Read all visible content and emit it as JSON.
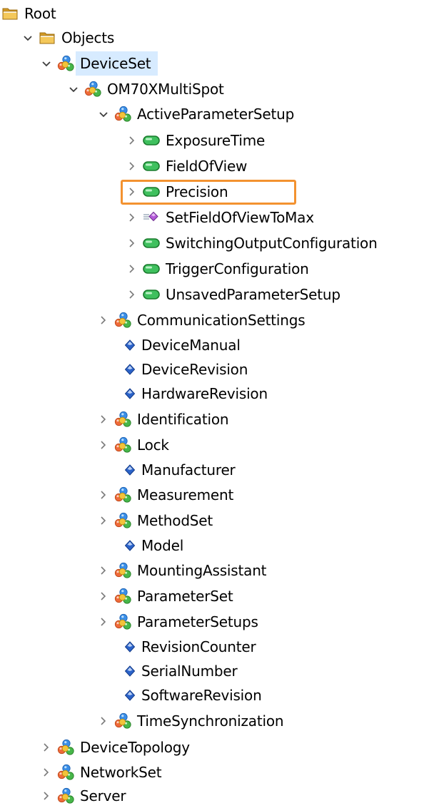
{
  "colors": {
    "highlight_border": "#f39230",
    "selection_fill": "#d7ebff",
    "chevron": "#7a7a7a",
    "folder": "#e9b844",
    "variable": "#2fb05a",
    "method": "#b35ad8",
    "property": "#2b63c9"
  },
  "icon_names": {
    "folder": "folder-icon",
    "object": "object-icon",
    "variable": "variable-icon",
    "method": "method-icon",
    "property": "property-icon"
  },
  "tree": {
    "root": {
      "label": "Root"
    },
    "objects": {
      "label": "Objects"
    },
    "device_set": {
      "label": "DeviceSet"
    },
    "om70x": {
      "label": "OM70XMultiSpot"
    },
    "active_parameter_setup": {
      "label": "ActiveParameterSetup"
    },
    "exposure_time": {
      "label": "ExposureTime"
    },
    "field_of_view": {
      "label": "FieldOfView"
    },
    "precision": {
      "label": "Precision"
    },
    "set_fov_to_max": {
      "label": "SetFieldOfViewToMax"
    },
    "switching_output_configuration": {
      "label": "SwitchingOutputConfiguration"
    },
    "trigger_configuration": {
      "label": "TriggerConfiguration"
    },
    "unsaved_parameter_setup": {
      "label": "UnsavedParameterSetup"
    },
    "communication_settings": {
      "label": "CommunicationSettings"
    },
    "device_manual": {
      "label": "DeviceManual"
    },
    "device_revision": {
      "label": "DeviceRevision"
    },
    "hardware_revision": {
      "label": "HardwareRevision"
    },
    "identification": {
      "label": "Identification"
    },
    "lock": {
      "label": "Lock"
    },
    "manufacturer": {
      "label": "Manufacturer"
    },
    "measurement": {
      "label": "Measurement"
    },
    "method_set": {
      "label": "MethodSet"
    },
    "model": {
      "label": "Model"
    },
    "mounting_assistant": {
      "label": "MountingAssistant"
    },
    "parameter_set": {
      "label": "ParameterSet"
    },
    "parameter_setups": {
      "label": "ParameterSetups"
    },
    "revision_counter": {
      "label": "RevisionCounter"
    },
    "serial_number": {
      "label": "SerialNumber"
    },
    "software_revision": {
      "label": "SoftwareRevision"
    },
    "time_synchronization": {
      "label": "TimeSynchronization"
    },
    "device_topology": {
      "label": "DeviceTopology"
    },
    "network_set": {
      "label": "NetworkSet"
    },
    "server": {
      "label": "Server"
    }
  }
}
